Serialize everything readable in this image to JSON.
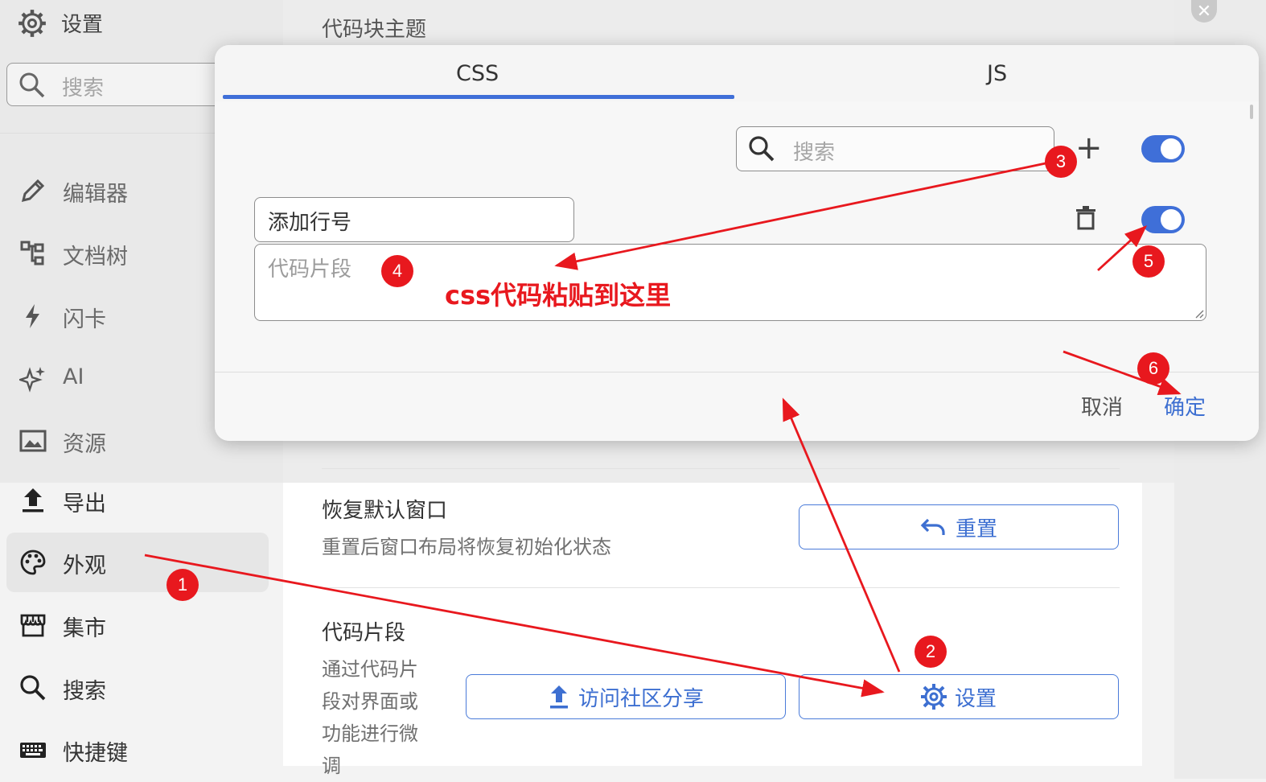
{
  "sidebar": {
    "header_title": "设置",
    "search_placeholder": "搜索",
    "items": [
      {
        "label": "编辑器",
        "icon": "pencil-icon"
      },
      {
        "label": "文档树",
        "icon": "tree-icon"
      },
      {
        "label": "闪卡",
        "icon": "lightning-icon"
      },
      {
        "label": "AI",
        "icon": "sparkle-icon"
      },
      {
        "label": "资源",
        "icon": "image-icon"
      },
      {
        "label": "导出",
        "icon": "upload-icon"
      },
      {
        "label": "外观",
        "icon": "palette-icon",
        "active": true
      },
      {
        "label": "集市",
        "icon": "store-icon"
      },
      {
        "label": "搜索",
        "icon": "search-icon"
      },
      {
        "label": "快捷键",
        "icon": "keyboard-icon"
      }
    ]
  },
  "main": {
    "code_theme_label": "代码块主题",
    "restore": {
      "title": "恢复默认窗口",
      "desc": "重置后窗口布局将恢复初始化状态",
      "button": "重置"
    },
    "snippets": {
      "title": "代码片段",
      "desc_lines": [
        "通过代码片",
        "段对界面或",
        "功能进行微",
        "调"
      ],
      "visit_button": "访问社区分享",
      "settings_button": "设置"
    }
  },
  "dialog": {
    "tabs": [
      "CSS",
      "JS"
    ],
    "active_tab": "CSS",
    "search_placeholder": "搜索",
    "add_label": "+",
    "snippet_name": "添加行号",
    "code_placeholder": "代码片段",
    "cancel": "取消",
    "confirm": "确定"
  },
  "annotations": {
    "markers": [
      "1",
      "2",
      "3",
      "4",
      "5",
      "6"
    ],
    "note": "css代码粘贴到这里",
    "color": "#e8181e"
  },
  "colors": {
    "accent": "#3f6fd8",
    "annotation": "#e8181e"
  }
}
